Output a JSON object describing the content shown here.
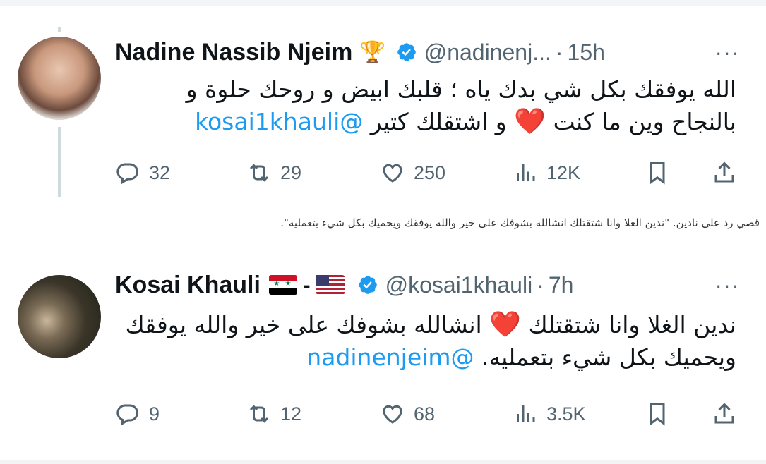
{
  "tweets": [
    {
      "name": "Nadine Nassib Njeim",
      "name_emoji": "🏆",
      "handle": "@nadinenj...",
      "separator": "·",
      "time": "15h",
      "more_label": "···",
      "text": "الله يوفقك بكل شي بدك ياه ؛ قلبك ابيض و روحك حلوة و بالنجاح وين ما كنت",
      "heart": "❤️",
      "text_after_heart": "و اشتقلك كتير",
      "mention": "@kosai1khauli",
      "replies": "32",
      "retweets": "29",
      "likes": "250",
      "views": "12K"
    },
    {
      "name": "Kosai Khauli",
      "name_dash": "-",
      "handle": "@kosai1khauli",
      "separator": "·",
      "time": "7h",
      "more_label": "···",
      "text_before_heart": "ندين الغلا وانا شتقتلك",
      "heart": "❤️",
      "text_after_heart": "انشالله بشوفك على خير والله يوفقك ويحميك بكل شيء بتعمليه.",
      "mention": "@nadinenjeim",
      "replies": "9",
      "retweets": "12",
      "likes": "68",
      "views": "3.5K"
    }
  ],
  "caption": "قصي رد على نادين. \"ندين الغلا وانا شتقتلك انشالله بشوفك على خير والله يوفقك ويحميك بكل شيء بتعمليه\".",
  "colors": {
    "accent": "#1d9bf0",
    "muted": "#536471",
    "text": "#0f1419",
    "heart": "#e0245e"
  },
  "icons": [
    "reply-icon",
    "retweet-icon",
    "like-icon",
    "views-icon",
    "bookmark-icon",
    "share-icon",
    "verified-icon",
    "trophy-icon",
    "syria-flag-icon",
    "usa-flag-icon"
  ]
}
